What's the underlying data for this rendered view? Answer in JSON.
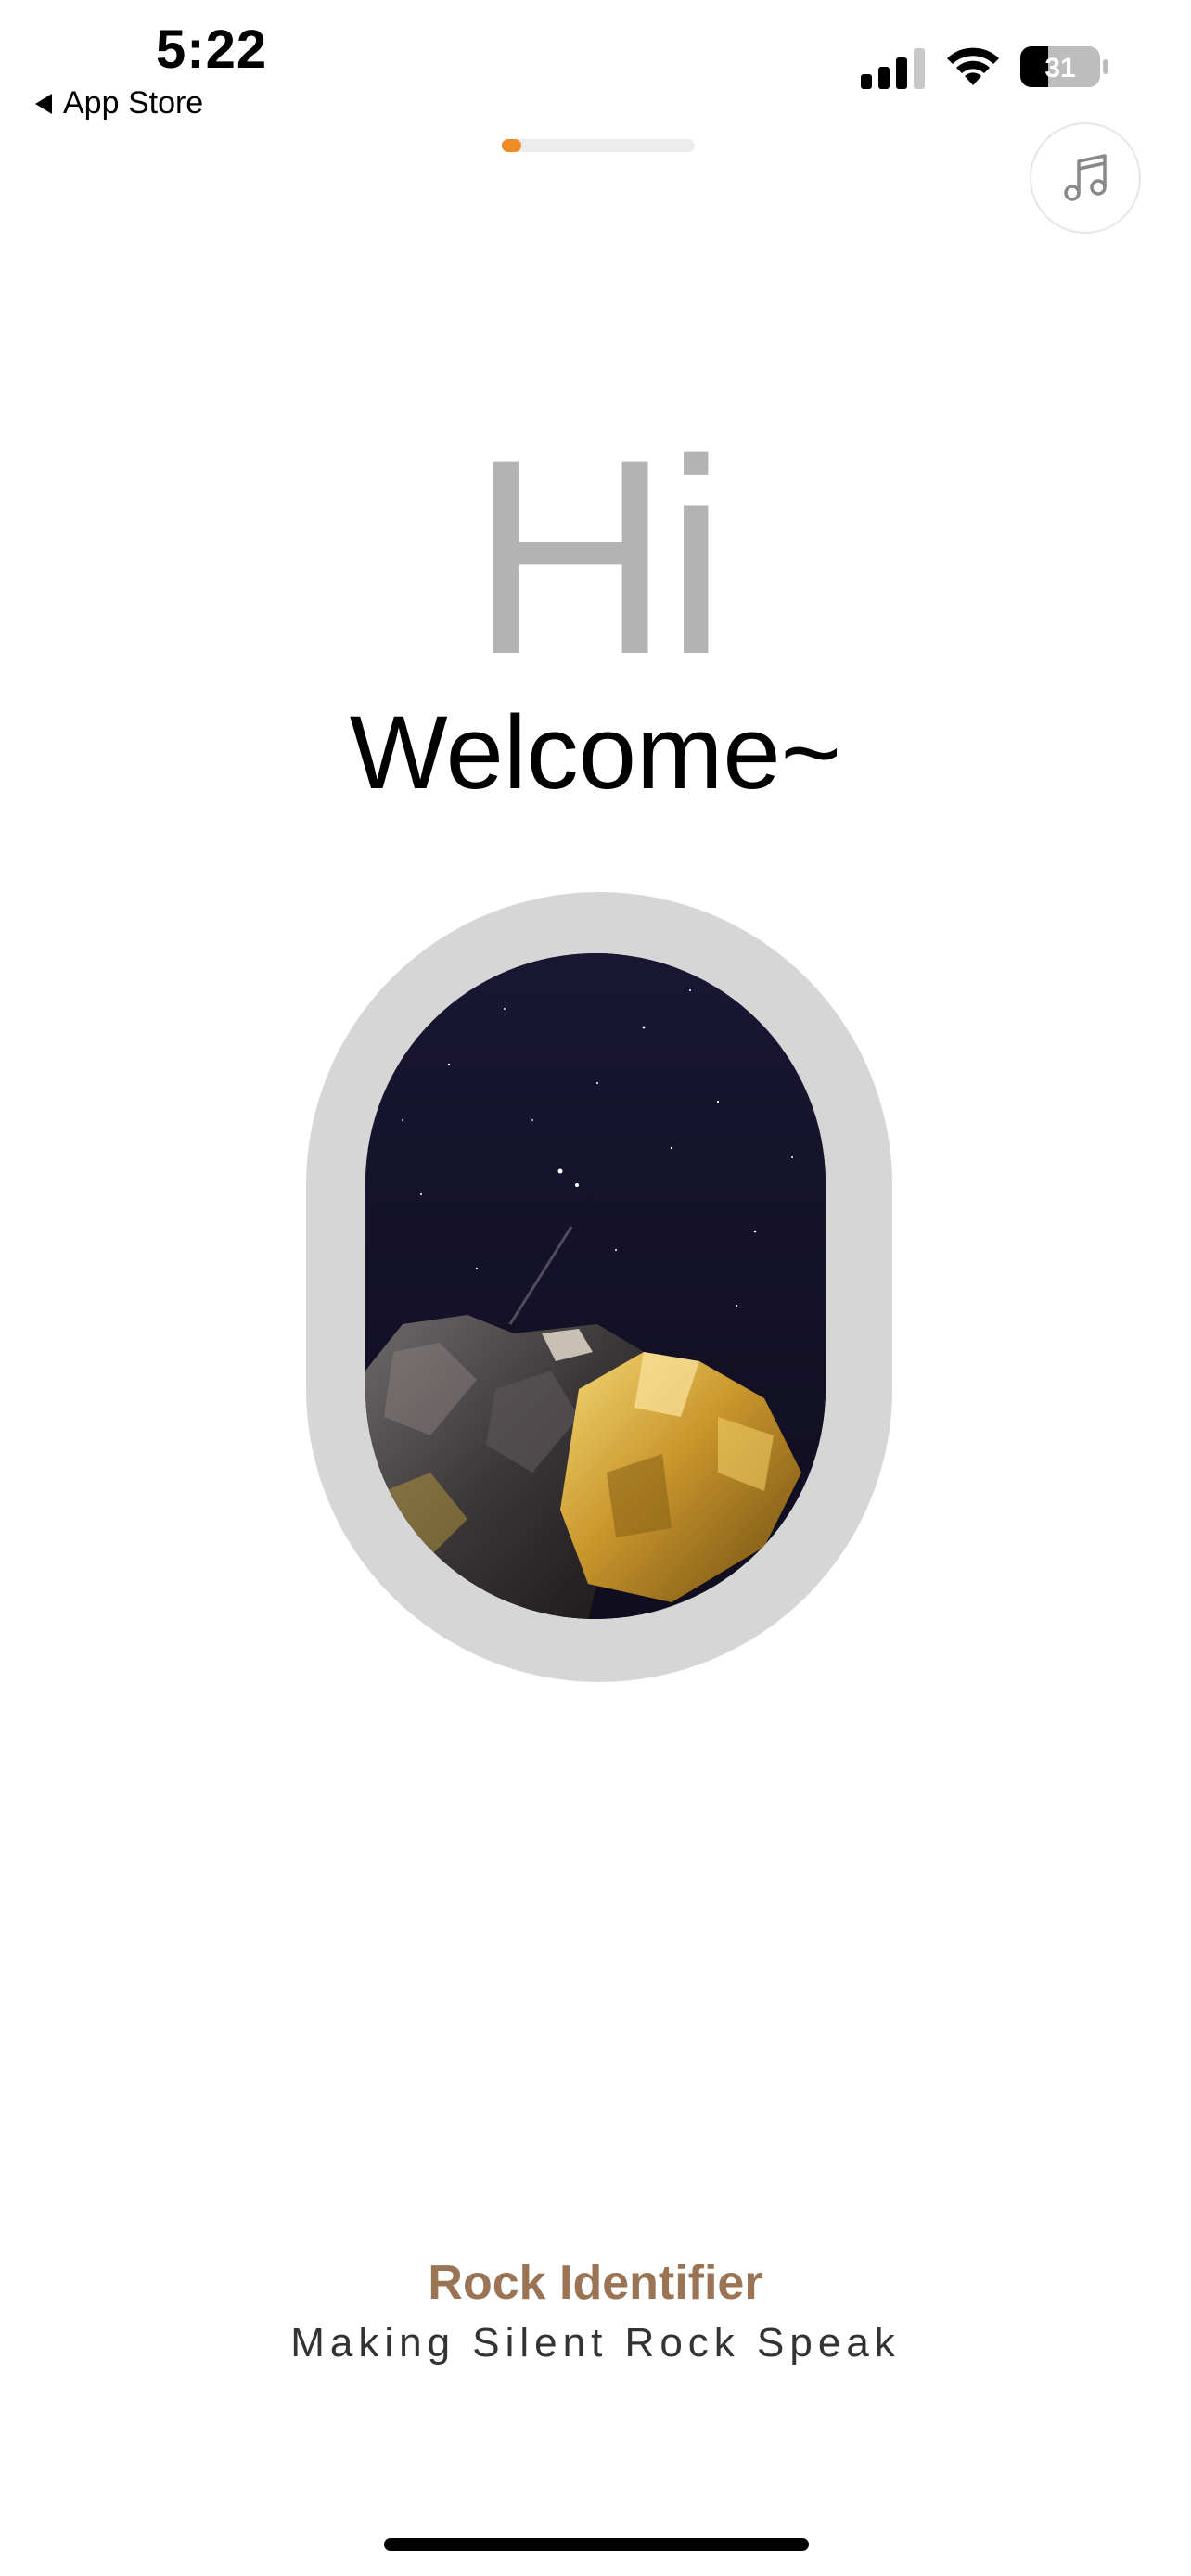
{
  "status_bar": {
    "time": "5:22",
    "back_app": "App Store",
    "battery_level": "31"
  },
  "onboarding": {
    "progress_fraction": 0.1,
    "accent_color": "#f08a24"
  },
  "icons": {
    "music": "music-note-icon",
    "back": "back-triangle-icon"
  },
  "hero": {
    "greeting": "Hi",
    "welcome": "Welcome~"
  },
  "footer": {
    "app_name": "Rock Identifier",
    "tagline": "Making Silent Rock Speak",
    "brand_color": "#9a7454"
  }
}
